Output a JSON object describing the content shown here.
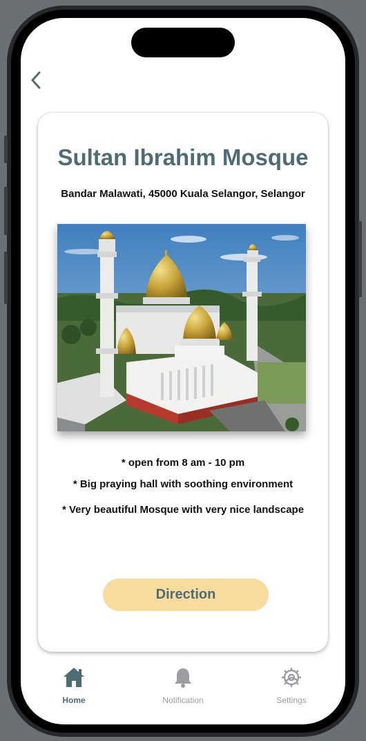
{
  "place": {
    "title": "Sultan Ibrahim Mosque",
    "address": "Bandar Malawati, 45000 Kuala Selangor, Selangor",
    "photo_subject": "mosque-photo"
  },
  "details": [
    "* open from 8 am - 10 pm",
    "* Big praying hall with soothing environment",
    "* Very beautiful Mosque with very nice landscape"
  ],
  "direction_label": "Direction",
  "tabs": [
    {
      "label": "Home",
      "icon": "home-icon",
      "active": true
    },
    {
      "label": "Notification",
      "icon": "bell-icon",
      "active": false
    },
    {
      "label": "Settings",
      "icon": "gear-icon",
      "active": false
    }
  ],
  "colors": {
    "accent": "#4f6b74",
    "button": "#f7dc9e",
    "inactive": "#9a9ea2"
  }
}
